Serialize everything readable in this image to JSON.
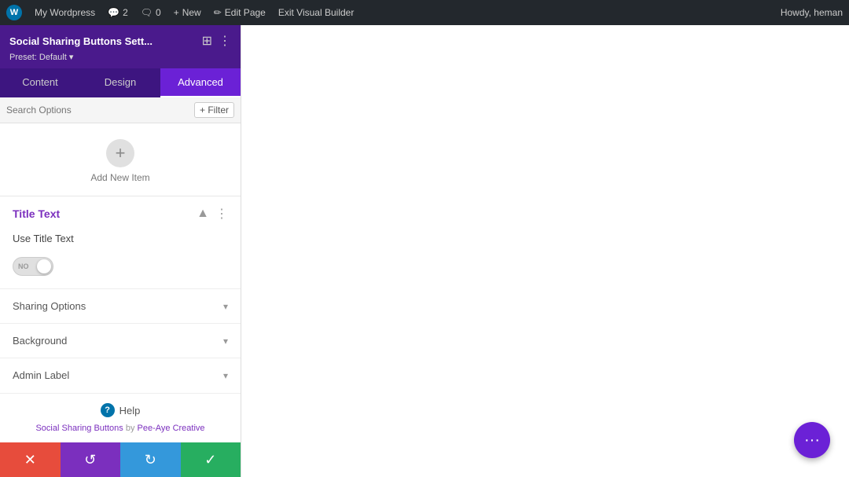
{
  "topbar": {
    "wp_label": "W",
    "site_name": "My Wordpress",
    "comments_count": "2",
    "speech_count": "0",
    "new_label": "New",
    "edit_page_label": "Edit Page",
    "exit_builder_label": "Exit Visual Builder",
    "howdy_text": "Howdy, heman"
  },
  "panel": {
    "title": "Social Sharing Buttons Sett...",
    "preset_label": "Preset: Default",
    "preset_arrow": "▾",
    "tabs": [
      {
        "id": "content",
        "label": "Content"
      },
      {
        "id": "design",
        "label": "Design"
      },
      {
        "id": "advanced",
        "label": "Advanced"
      }
    ],
    "active_tab": "advanced"
  },
  "search": {
    "placeholder": "Search Options",
    "filter_label": "+ Filter"
  },
  "add_item": {
    "label": "Add New Item"
  },
  "title_text": {
    "section_label": "Title Text",
    "field_label": "Use Title Text",
    "toggle_state": "NO"
  },
  "sections": [
    {
      "id": "sharing-options",
      "label": "Sharing Options"
    },
    {
      "id": "background",
      "label": "Background"
    },
    {
      "id": "admin-label",
      "label": "Admin Label"
    }
  ],
  "footer": {
    "help_label": "Help",
    "credit_text": "Social Sharing Buttons",
    "credit_by": "by",
    "credit_author": "Pee-Aye Creative"
  },
  "toolbar": {
    "cancel_icon": "✕",
    "undo_icon": "↺",
    "redo_icon": "↻",
    "save_icon": "✓"
  },
  "fab": {
    "icon": "•••"
  }
}
